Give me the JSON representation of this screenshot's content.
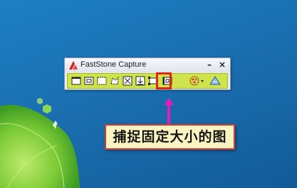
{
  "desktop": {
    "background_color": "#1a73b8",
    "wallpaper": "windows-7-green-leaf"
  },
  "capture_toolbar": {
    "title": "FastStone Capture",
    "minimize_label": "–",
    "close_label": "×",
    "strip_color": "#cfe34d",
    "tools": [
      {
        "icon": "capture-active-window-icon"
      },
      {
        "icon": "capture-window-object-icon"
      },
      {
        "icon": "capture-rectangular-region-icon"
      },
      {
        "icon": "capture-freehand-region-icon"
      },
      {
        "icon": "capture-full-screen-icon"
      },
      {
        "icon": "capture-scrolling-window-icon"
      },
      {
        "icon": "capture-fixed-region-icon"
      },
      {
        "icon": "screen-recorder-icon"
      },
      {
        "icon": "output-settings-icon"
      },
      {
        "icon": "settings-icon"
      }
    ]
  },
  "annotation": {
    "callout_text": "捕捉固定大小的图",
    "arrow_color": "#e01fb6",
    "highlight_color": "#e0241b"
  }
}
